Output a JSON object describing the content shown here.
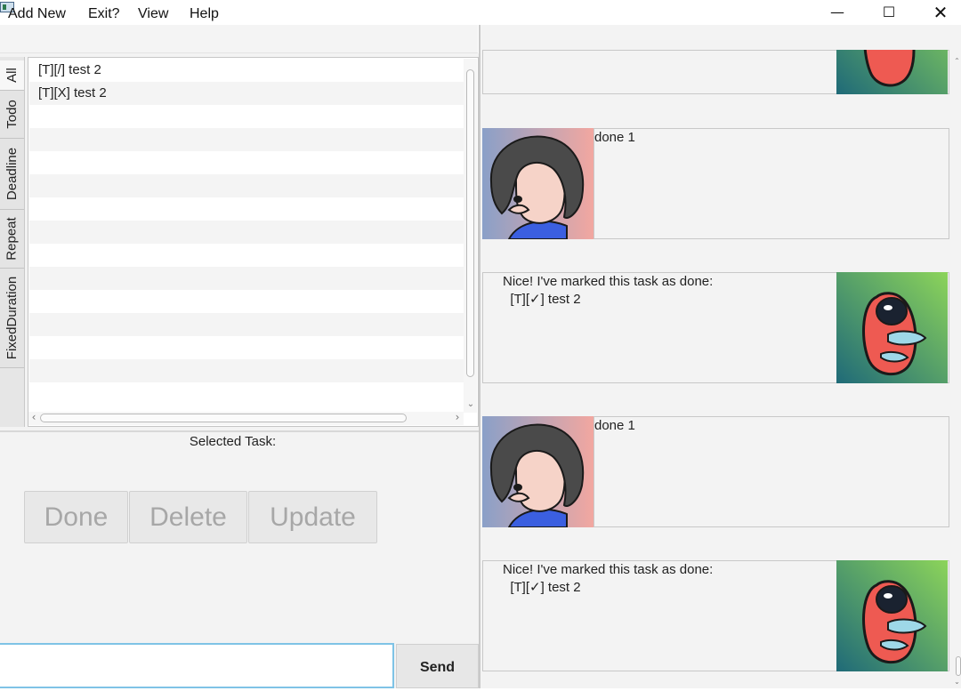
{
  "window": {
    "minimize_glyph": "—",
    "maximize_glyph": "☐",
    "close_glyph": "✕"
  },
  "menu": {
    "add_new": "Add New",
    "exit": "Exit?",
    "view": "View",
    "help": "Help"
  },
  "tabs": {
    "all": "All",
    "todo": "Todo",
    "deadline": "Deadline",
    "repeat": "Repeat",
    "fixed_duration": "FixedDuration"
  },
  "task_list": {
    "items": [
      "[T][/] test 2",
      "[T][X] test 2"
    ]
  },
  "selected_task": {
    "label": "Selected Task:"
  },
  "buttons": {
    "done": "Done",
    "delete": "Delete",
    "update": "Update",
    "send": "Send"
  },
  "input": {
    "value": ""
  },
  "dialog": {
    "user_message_1": "done 1",
    "duke_message_1": "Nice! I've marked this task as done:\n  [T][✓] test 2",
    "user_message_2": "done 1",
    "duke_message_2": "Nice! I've marked this task as done:\n  [T][✓] test 2"
  },
  "colors": {
    "accent_focus": "#7fc3e6",
    "duke_bg_dark": "#1f6a78",
    "duke_bg_light": "#8cd45a",
    "duke_body": "#ee5a52",
    "user_bg_left": "#8aa0c8",
    "user_bg_right": "#f2a7a0",
    "user_shirt": "#3b5fe0"
  }
}
